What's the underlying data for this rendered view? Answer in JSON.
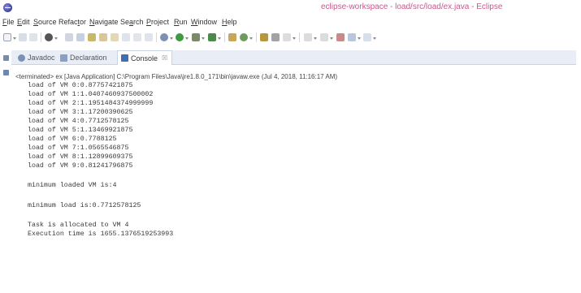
{
  "window": {
    "title": "eclipse-workspace - load/src/load/ex.java - Eclipse"
  },
  "menubar": {
    "items": [
      {
        "label": "File"
      },
      {
        "label": "Edit"
      },
      {
        "label": "Source"
      },
      {
        "label": "Refactor"
      },
      {
        "label": "Navigate"
      },
      {
        "label": "Search"
      },
      {
        "label": "Project"
      },
      {
        "label": "Run"
      },
      {
        "label": "Window"
      },
      {
        "label": "Help"
      }
    ]
  },
  "toolbar": {
    "icons": [
      "new-icon",
      "save-icon",
      "save-all-icon",
      "debug-icon",
      "run-icon",
      "external-tools-icon",
      "new-package-icon",
      "new-class-icon",
      "open-type-icon",
      "search-icon",
      "annotation-icon",
      "back-icon",
      "forward-icon"
    ]
  },
  "tabs": [
    {
      "label": "Javadoc",
      "active": false
    },
    {
      "label": "Declaration",
      "active": false
    },
    {
      "label": "Console",
      "active": true,
      "close": "☒"
    }
  ],
  "console": {
    "status": "<terminated> ex [Java Application] C:\\Program Files\\Java\\jre1.8.0_171\\bin\\javaw.exe (Jul 4, 2018, 11:16:17 AM)",
    "lines": [
      "load of VM 0:0.87757421875",
      "load of VM 1:1.0407460937500002",
      "load of VM 2:1.1951484374999999",
      "load of VM 3:1.17200390625",
      "load of VM 4:0.7712578125",
      "load of VM 5:1.13469921875",
      "load of VM 6:0.7788125",
      "load of VM 7:1.0565546875",
      "load of VM 8:1.12899609375",
      "load of VM 9:0.81241796875",
      "",
      "minimum loaded VM is:4",
      "",
      "minimum load is:0.7712578125",
      "",
      "Task is allocated to VM 4",
      "Execution time is 1655.1376519253993"
    ]
  },
  "colors": {
    "title": "#c55a8a",
    "tabbar_bg": "#e9eef6",
    "console_text": "#3a3a3a"
  }
}
